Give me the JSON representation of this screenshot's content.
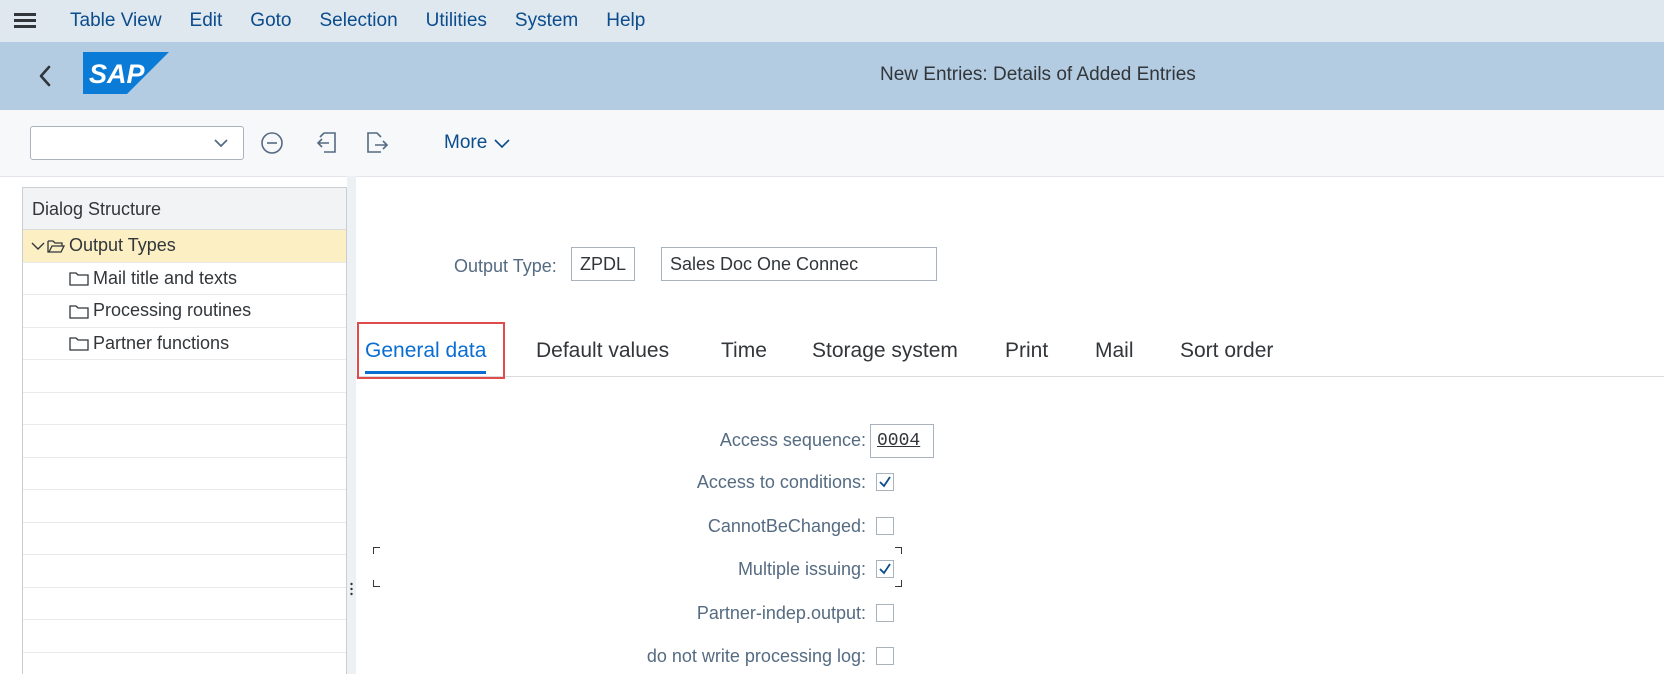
{
  "menu": {
    "items": [
      {
        "label": "Table View"
      },
      {
        "label": "Edit"
      },
      {
        "label": "Goto"
      },
      {
        "label": "Selection"
      },
      {
        "label": "Utilities"
      },
      {
        "label": "System"
      },
      {
        "label": "Help"
      }
    ]
  },
  "header": {
    "logo_text": "SAP",
    "title": "New Entries: Details of Added Entries"
  },
  "toolbar": {
    "command_field_value": "",
    "more_label": "More"
  },
  "dialog_structure": {
    "title": "Dialog Structure",
    "nodes": [
      {
        "label": "Output Types",
        "selected": true,
        "expanded": true
      },
      {
        "label": "Mail title and texts"
      },
      {
        "label": "Processing routines"
      },
      {
        "label": "Partner functions"
      }
    ]
  },
  "output_type": {
    "label": "Output Type:",
    "code": "ZPDL",
    "description": "Sales Doc One Connec"
  },
  "tabs": [
    {
      "label": "General data",
      "active": true
    },
    {
      "label": "Default values"
    },
    {
      "label": "Time"
    },
    {
      "label": "Storage system"
    },
    {
      "label": "Print"
    },
    {
      "label": "Mail"
    },
    {
      "label": "Sort order"
    }
  ],
  "general_data": {
    "access_sequence": {
      "label": "Access sequence:",
      "value": "0004"
    },
    "access_to_conditions": {
      "label": "Access to conditions:",
      "checked": true
    },
    "cannot_be_changed": {
      "label": "CannotBeChanged:",
      "checked": false
    },
    "multiple_issuing": {
      "label": "Multiple issuing:",
      "checked": true
    },
    "partner_indep_output": {
      "label": "Partner-indep.output:",
      "checked": false
    },
    "no_processing_log": {
      "label": "do not write processing log:",
      "checked": false
    }
  },
  "colors": {
    "menubar_bg": "#dfe7ef",
    "titlebar_bg": "#b3cce2",
    "link_blue": "#0a4c8c",
    "active_tab": "#0a6ed1",
    "selected_row": "#fbefc3",
    "highlight": "#e04b4b"
  }
}
